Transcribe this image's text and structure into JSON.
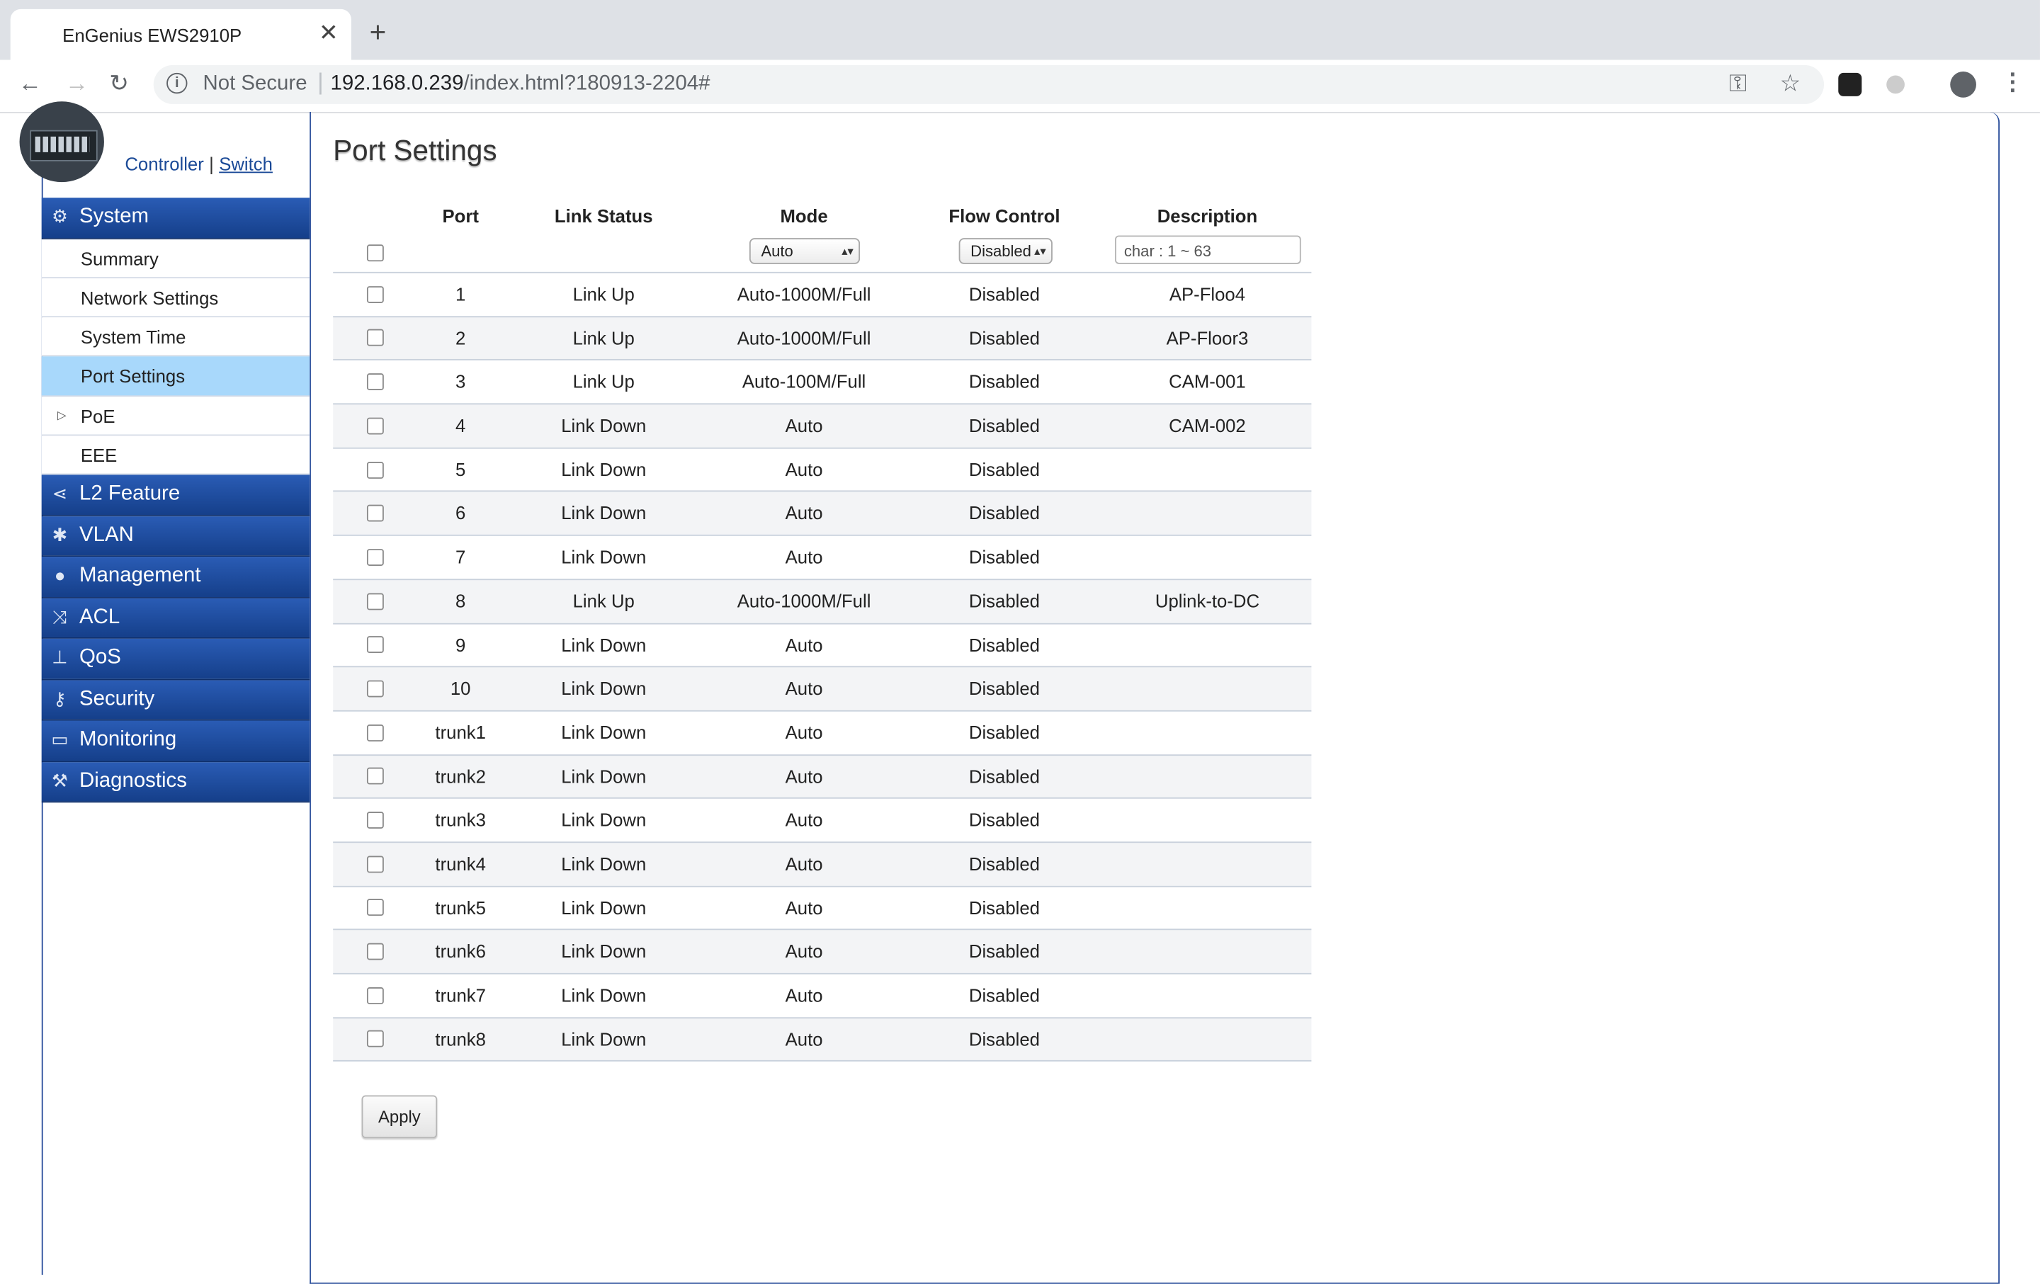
{
  "browser": {
    "tab_title": "EnGenius EWS2910P",
    "tab_close": "✕",
    "new_tab": "+",
    "security_label": "Not Secure",
    "url_host": "192.168.0.239",
    "url_path": "/index.html?180913-2204#"
  },
  "brand": {
    "controller_link": "Controller",
    "separator": "|",
    "switch_link": "Switch"
  },
  "sidebar": {
    "system": {
      "label": "System",
      "items": [
        "Summary",
        "Network Settings",
        "System Time",
        "Port Settings",
        "PoE",
        "EEE"
      ],
      "active_item": "Port Settings"
    },
    "sections": [
      {
        "label": "L2 Feature",
        "icon": "share-icon"
      },
      {
        "label": "VLAN",
        "icon": "network-icon"
      },
      {
        "label": "Management",
        "icon": "user-icon"
      },
      {
        "label": "ACL",
        "icon": "shuffle-icon"
      },
      {
        "label": "QoS",
        "icon": "qos-icon"
      },
      {
        "label": "Security",
        "icon": "key-icon"
      },
      {
        "label": "Monitoring",
        "icon": "monitor-icon"
      },
      {
        "label": "Diagnostics",
        "icon": "wrench-icon"
      }
    ]
  },
  "main": {
    "title": "Port Settings",
    "columns": [
      "Port",
      "Link Status",
      "Mode",
      "Flow Control",
      "Description"
    ],
    "filter": {
      "mode_value": "Auto",
      "flow_value": "Disabled",
      "desc_placeholder": "char : 1 ~ 63"
    },
    "rows": [
      {
        "port": "1",
        "link": "Link Up",
        "mode": "Auto-1000M/Full",
        "flow": "Disabled",
        "desc": "AP-Floo4"
      },
      {
        "port": "2",
        "link": "Link Up",
        "mode": "Auto-1000M/Full",
        "flow": "Disabled",
        "desc": "AP-Floor3"
      },
      {
        "port": "3",
        "link": "Link Up",
        "mode": "Auto-100M/Full",
        "flow": "Disabled",
        "desc": "CAM-001"
      },
      {
        "port": "4",
        "link": "Link Down",
        "mode": "Auto",
        "flow": "Disabled",
        "desc": "CAM-002"
      },
      {
        "port": "5",
        "link": "Link Down",
        "mode": "Auto",
        "flow": "Disabled",
        "desc": ""
      },
      {
        "port": "6",
        "link": "Link Down",
        "mode": "Auto",
        "flow": "Disabled",
        "desc": ""
      },
      {
        "port": "7",
        "link": "Link Down",
        "mode": "Auto",
        "flow": "Disabled",
        "desc": ""
      },
      {
        "port": "8",
        "link": "Link Up",
        "mode": "Auto-1000M/Full",
        "flow": "Disabled",
        "desc": "Uplink-to-DC"
      },
      {
        "port": "9",
        "link": "Link Down",
        "mode": "Auto",
        "flow": "Disabled",
        "desc": ""
      },
      {
        "port": "10",
        "link": "Link Down",
        "mode": "Auto",
        "flow": "Disabled",
        "desc": ""
      },
      {
        "port": "trunk1",
        "link": "Link Down",
        "mode": "Auto",
        "flow": "Disabled",
        "desc": ""
      },
      {
        "port": "trunk2",
        "link": "Link Down",
        "mode": "Auto",
        "flow": "Disabled",
        "desc": ""
      },
      {
        "port": "trunk3",
        "link": "Link Down",
        "mode": "Auto",
        "flow": "Disabled",
        "desc": ""
      },
      {
        "port": "trunk4",
        "link": "Link Down",
        "mode": "Auto",
        "flow": "Disabled",
        "desc": ""
      },
      {
        "port": "trunk5",
        "link": "Link Down",
        "mode": "Auto",
        "flow": "Disabled",
        "desc": ""
      },
      {
        "port": "trunk6",
        "link": "Link Down",
        "mode": "Auto",
        "flow": "Disabled",
        "desc": ""
      },
      {
        "port": "trunk7",
        "link": "Link Down",
        "mode": "Auto",
        "flow": "Disabled",
        "desc": ""
      },
      {
        "port": "trunk8",
        "link": "Link Down",
        "mode": "Auto",
        "flow": "Disabled",
        "desc": ""
      }
    ],
    "apply_label": "Apply"
  },
  "colors": {
    "accent": "#1b4a97",
    "nav_header": "#1f4f9f",
    "active_item": "#a8d8fb"
  }
}
